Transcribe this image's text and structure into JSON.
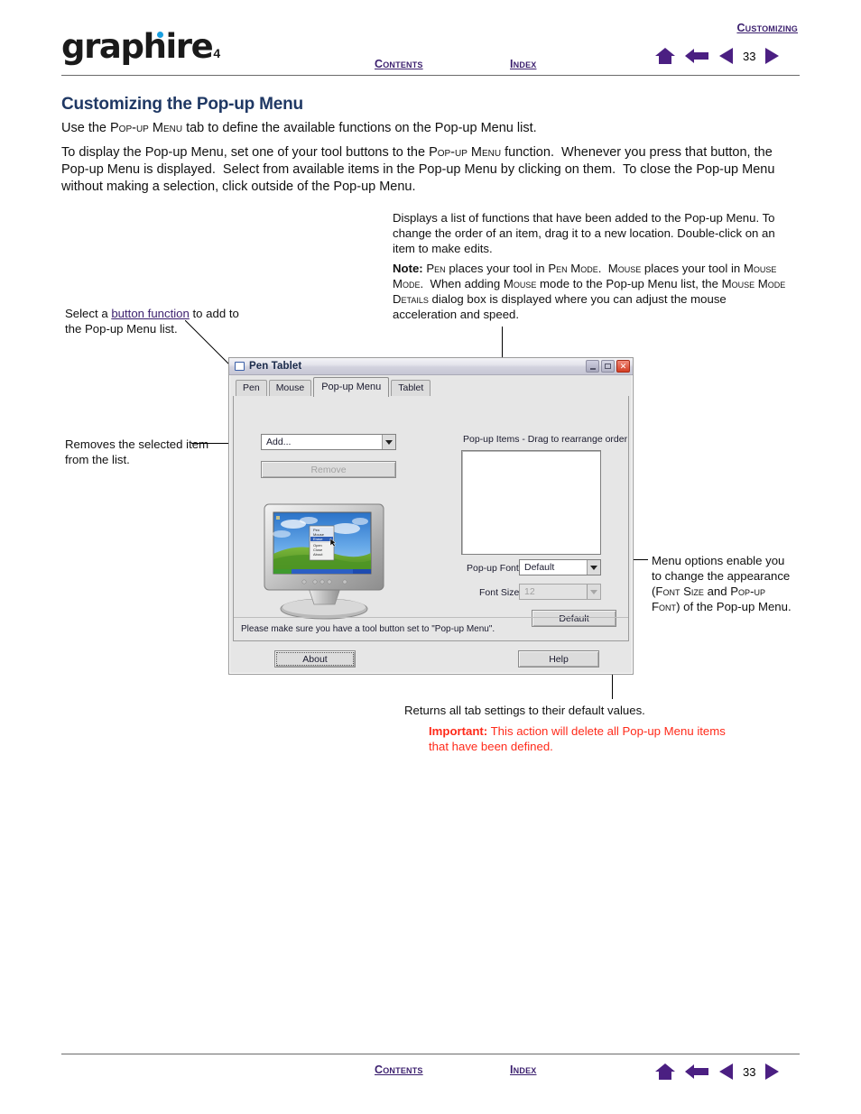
{
  "header": {
    "section_label": "Customizing",
    "logo_text": "graphire",
    "logo_sup": "4",
    "contents_label": "Contents",
    "index_label": "Index",
    "page_number": "33",
    "icons": [
      "home-icon",
      "back-arrow-icon",
      "previous-page-icon",
      "next-page-icon"
    ],
    "nav_color": "#4b1f82"
  },
  "footer": {
    "contents_label": "Contents",
    "index_label": "Index",
    "page_number": "33"
  },
  "main": {
    "title": "Customizing the Pop-up Menu",
    "paragraph_1": "Use the POP-UP MENU tab to define the available functions on the Pop-up Menu list.",
    "paragraph_2": "To display the Pop-up Menu, set one of your tool buttons to the POP-UP MENU function.  Whenever you press that button, the Pop-up Menu is displayed.  Select from available items in the Pop-up Menu by clicking on them.  To close the Pop-up Menu without making a selection, click outside of the Pop-up Menu."
  },
  "annotations": {
    "list_description": "Displays a list of functions that have been added to the Pop-up Menu. To change the order of an item, drag it to a new location. Double-click on an item to make edits.",
    "note_label": "Note:",
    "note_body": "PEN places your tool in PEN MODE.  MOUSE places your tool in MOUSE MODE.  When adding MOUSE mode to the Pop-up Menu list, the MOUSE MODE DETAILS dialog box is displayed where you can adjust the mouse acceleration and speed.",
    "select_prefix": "Select a ",
    "select_link": "button function",
    "select_suffix": " to add to the Pop-up Menu list.",
    "remove_description": "Removes the selected item from the list.",
    "menu_options_description": "Menu options enable you to change the appearance (FONT SIZE and POP-UP FONT) of the Pop-up Menu.",
    "returns_description": "Returns all tab settings to their default values.",
    "important_label": "Important:",
    "important_body": " This action will delete all Pop-up Menu items that have been defined.",
    "important_color": "#ff2a1a"
  },
  "dialog": {
    "title": "Pen Tablet",
    "window_buttons": [
      "minimize-button",
      "maximize-button",
      "close-button"
    ],
    "tabs": [
      {
        "label": "Pen",
        "active": false
      },
      {
        "label": "Mouse",
        "active": false
      },
      {
        "label": "Pop-up Menu",
        "active": true
      },
      {
        "label": "Tablet",
        "active": false
      }
    ],
    "add_dropdown_value": "Add...",
    "remove_button_label": "Remove",
    "remove_button_enabled": false,
    "popup_items_label": "Pop-up Items - Drag to rearrange order",
    "popup_items": [],
    "popup_font_label": "Pop-up Font",
    "popup_font_value": "Default",
    "font_size_label": "Font Size",
    "font_size_value": "12",
    "font_size_enabled": false,
    "default_button_label": "Default",
    "status_text": "Please make sure you have a tool button set to \"Pop-up Menu\".",
    "about_button_label": "About",
    "help_button_label": "Help",
    "monitor_preview": {
      "name": "monitor-preview",
      "popup_menu_items": [
        "Pen",
        "Mouse",
        "Erase",
        "Open",
        "Close",
        "About"
      ],
      "highlighted_item": "Erase"
    }
  }
}
